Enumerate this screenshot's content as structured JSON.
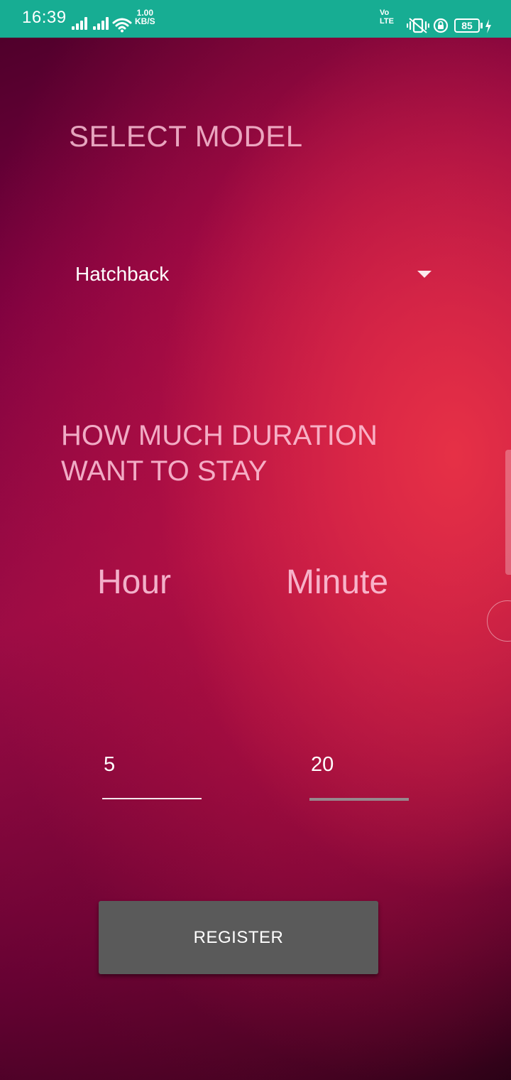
{
  "status_bar": {
    "time": "16:39",
    "net_speed_value": "1.00",
    "net_speed_unit": "KB/S",
    "volte_top": "Vo",
    "volte_bottom": "LTE",
    "battery_level": "85",
    "background_color": "#17ad93"
  },
  "form": {
    "select_model_heading": "SELECT MODEL",
    "model_spinner": {
      "selected": "Hatchback"
    },
    "duration_question_line1": "HOW MUCH DURATION",
    "duration_question_line2": "WANT TO STAY",
    "hour_label": "Hour",
    "minute_label": "Minute",
    "hour_value": "5",
    "minute_value": "20",
    "register_label": "REGISTER"
  },
  "colors": {
    "button_background": "#5a5a5a",
    "heading_text": "#ffc8dc"
  }
}
